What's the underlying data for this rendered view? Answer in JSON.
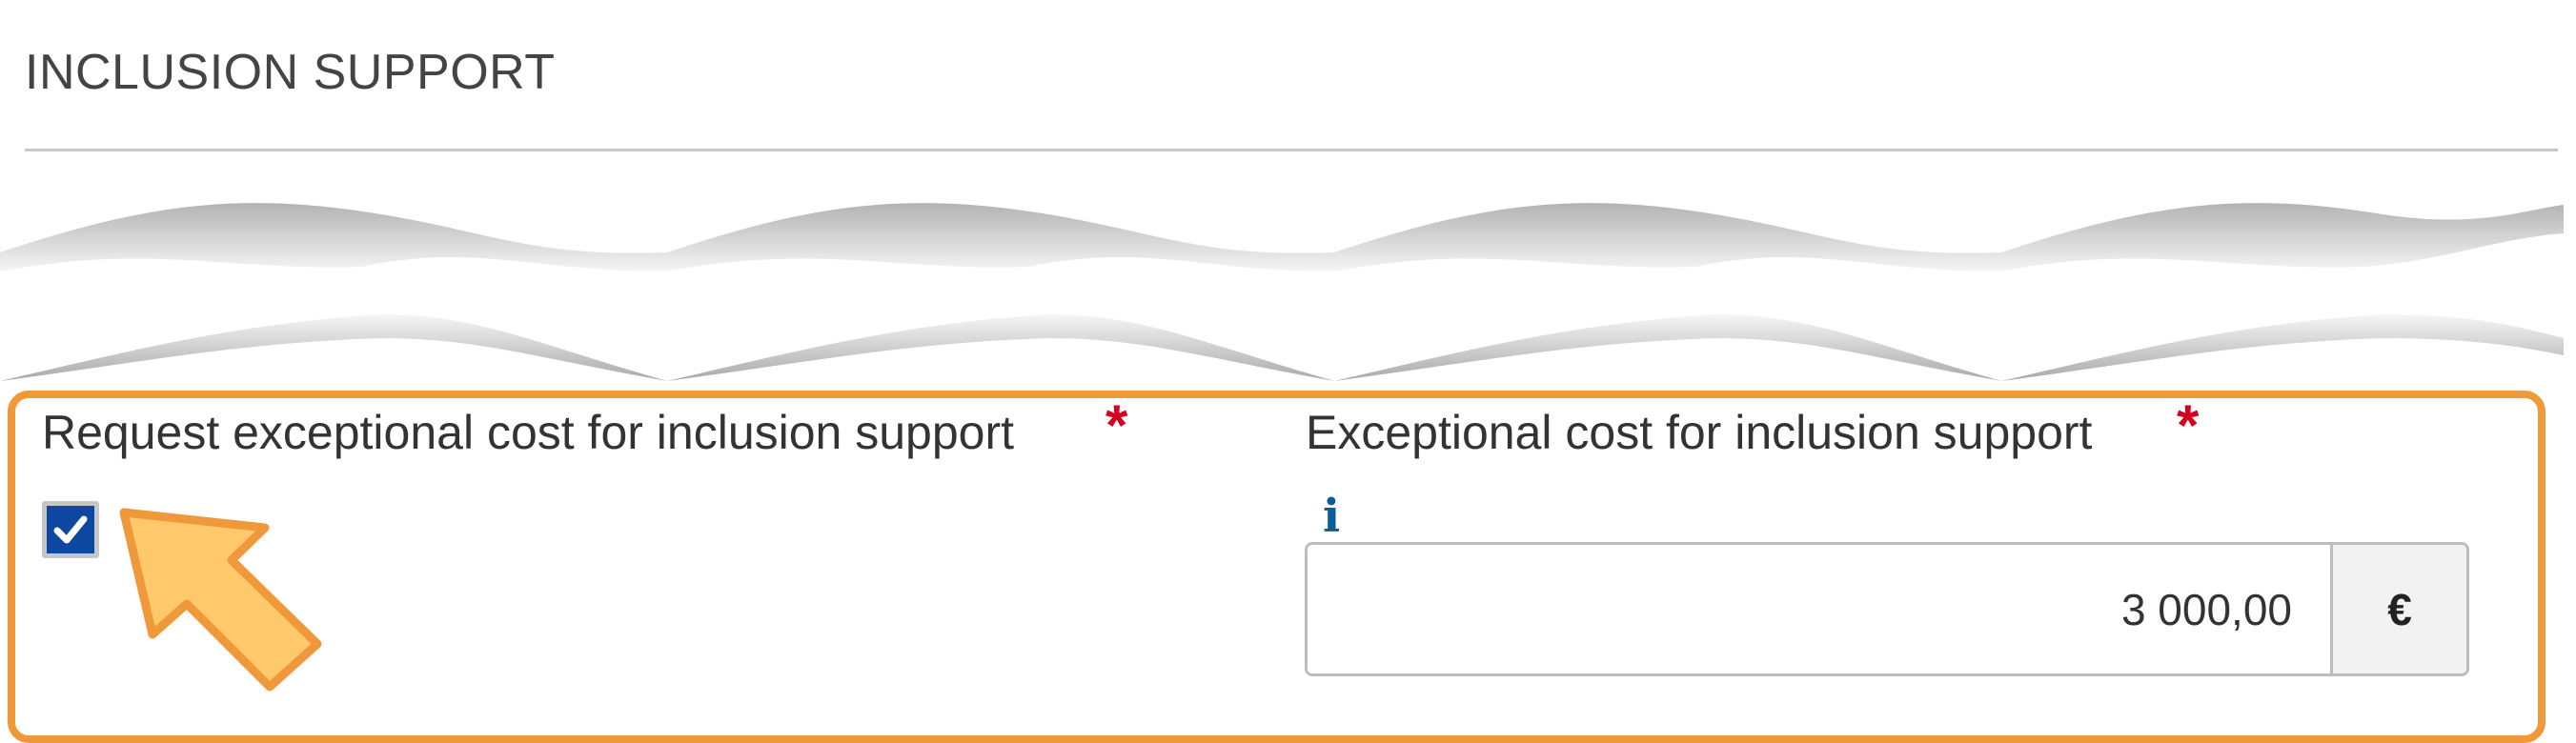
{
  "section": {
    "title": "INCLUSION SUPPORT"
  },
  "fields": {
    "request": {
      "label": "Request exceptional cost for inclusion support",
      "required_mark": "*",
      "checked": true
    },
    "cost": {
      "label": "Exceptional cost for inclusion support",
      "required_mark": "*",
      "info_icon": "i",
      "value": "3 000,00",
      "currency": "€"
    }
  },
  "colors": {
    "highlight": "#f0993a",
    "required": "#d5001f",
    "checkbox": "#0e47a1",
    "info": "#0b5c9b",
    "arrow_fill": "#ffc86b"
  }
}
